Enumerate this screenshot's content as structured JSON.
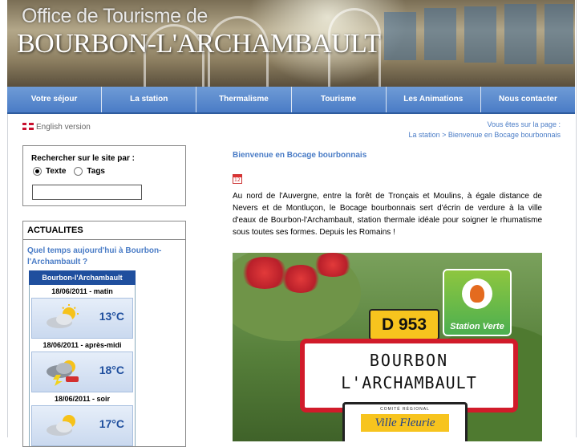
{
  "header": {
    "line1": "Office de Tourisme de",
    "line2": "BOURBON-L'ARCHAMBAULT"
  },
  "nav": [
    {
      "label": "Votre séjour"
    },
    {
      "label": "La station"
    },
    {
      "label": "Thermalisme"
    },
    {
      "label": "Tourisme"
    },
    {
      "label": "Les Animations"
    },
    {
      "label": "Nous contacter"
    }
  ],
  "lang": {
    "label": "English version"
  },
  "breadcrumb": {
    "prefix": "Vous êtes sur la page :",
    "level1": "La station",
    "separator": ">",
    "current": "Bienvenue en Bocage bourbonnais"
  },
  "search": {
    "label": "Rechercher sur le site par :",
    "option_text": "Texte",
    "option_tags": "Tags",
    "value": "",
    "selected": "Texte"
  },
  "news": {
    "heading": "ACTUALITES",
    "question": "Quel temps aujourd'hui à Bourbon-l'Archambault ?",
    "weather": {
      "city": "Bourbon-l'Archambault",
      "slots": [
        {
          "date": "18/06/2011 - matin",
          "temp": "13°C",
          "icon": "partly-cloudy-icon"
        },
        {
          "date": "18/06/2011 - après-midi",
          "temp": "18°C",
          "icon": "storm-icon"
        },
        {
          "date": "18/06/2011 - soir",
          "temp": "17°C",
          "icon": "partly-cloudy-icon"
        }
      ]
    }
  },
  "main": {
    "title": "Bienvenue en Bocage bourbonnais",
    "paragraph": "Au nord de l'Auvergne, entre la forêt de Tronçais et Moulins, à égale distance de Nevers et de Montluçon, le Bocage bourbonnais sert d'écrin de verdure à la ville d'eaux de Bourbon-l'Archambault, station thermale idéale pour soigner le rhumatisme sous toutes ses formes. Depuis les Romains !",
    "photo": {
      "road_number": "D 953",
      "town_line1": "BOURBON",
      "town_line2": "L'ARCHAMBAULT",
      "badge": "Station Verte",
      "small_sign_top": "COMITÉ      RÉGIONAL",
      "small_sign_main": "Ville Fleurie"
    }
  },
  "colors": {
    "nav_blue": "#4a7cc6",
    "link_blue": "#4a7cc6",
    "weather_header": "#1f4f9e"
  }
}
